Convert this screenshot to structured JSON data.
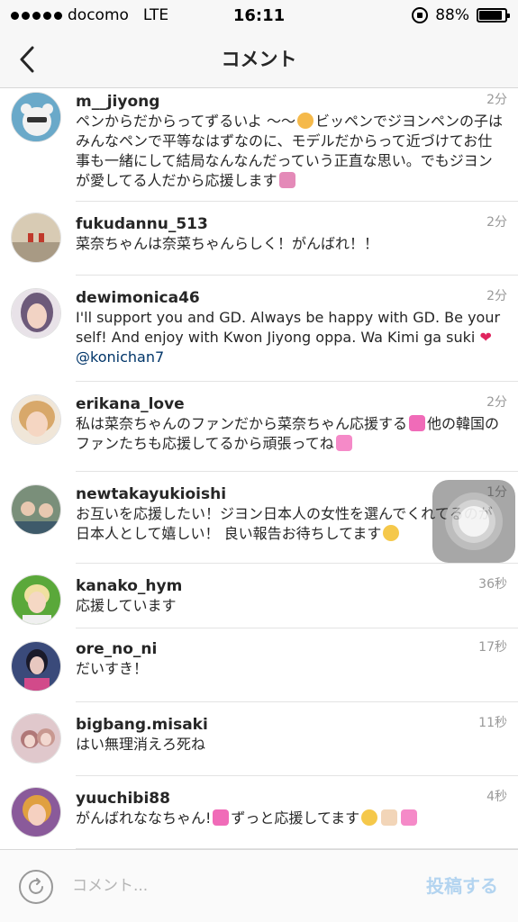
{
  "status_bar": {
    "carrier": "docomo",
    "network": "LTE",
    "time": "16:11",
    "battery": "88%",
    "battery_level": 0.88
  },
  "nav": {
    "title": "コメント",
    "back_icon": "chevron-left-icon"
  },
  "comments": [
    {
      "username": "m__jiyong",
      "time": "2分",
      "text_parts": [
        "ペンからだからってずるいよ 〜〜",
        "ビッペンでジヨンペンの子はみんなペンで平等なはずなのに、モデルだからって近づけてお仕事も一緒にして結局なんなんだっていう正直な思い。でもジヨンが愛してる人だから応援します"
      ],
      "avatar_color": "#6aa9c9"
    },
    {
      "username": "fukudannu_513",
      "time": "2分",
      "text": "菜奈ちゃんは奈菜ちゃんらしく！がんばれ！！",
      "avatar_color": "#c8b9a0"
    },
    {
      "username": "dewimonica46",
      "time": "2分",
      "text": "I'll support you and GD. Always be happy with GD. Be yourself! And enjoy with Kwon Jiyong oppa. Wa Kimi ga suki",
      "mention": "@konichan7",
      "avatar_color": "#7a6a8a"
    },
    {
      "username": "erikana_love",
      "time": "2分",
      "text_parts": [
        "私は菜奈ちゃんのファンだから菜奈ちゃん応援する",
        "他の韓国のファンたちも応援してるから頑張ってね"
      ],
      "avatar_color": "#d9b48a"
    },
    {
      "username": "newtakayukioishi",
      "time": "1分",
      "text": "お互いを応援したい！ジヨン日本人の女性を選んでくれてるのが日本人として嬉しい！ 良い報告お待ちしてます",
      "avatar_color": "#5c7a6a"
    },
    {
      "username": "kanako_hym",
      "time": "36秒",
      "text": "応援しています",
      "avatar_color": "#8cc26a"
    },
    {
      "username": "ore_no_ni",
      "time": "17秒",
      "text": "だいすき！",
      "avatar_color": "#4a5a8a"
    },
    {
      "username": "bigbang.misaki",
      "time": "11秒",
      "text": "はい無理消えろ死ね",
      "avatar_color": "#c99aa8"
    },
    {
      "username": "yuuchibi88",
      "time": "4秒",
      "text_parts": [
        "がんばれななちゃん!",
        "ずっと応援してます"
      ],
      "avatar_color": "#9a6a9a"
    }
  ],
  "input_bar": {
    "placeholder": "コメント...",
    "post_label": "投稿する",
    "refresh_icon": "refresh-icon"
  },
  "colors": {
    "link": "#003569",
    "post_disabled": "#b3d4f0",
    "meta": "#999999"
  }
}
